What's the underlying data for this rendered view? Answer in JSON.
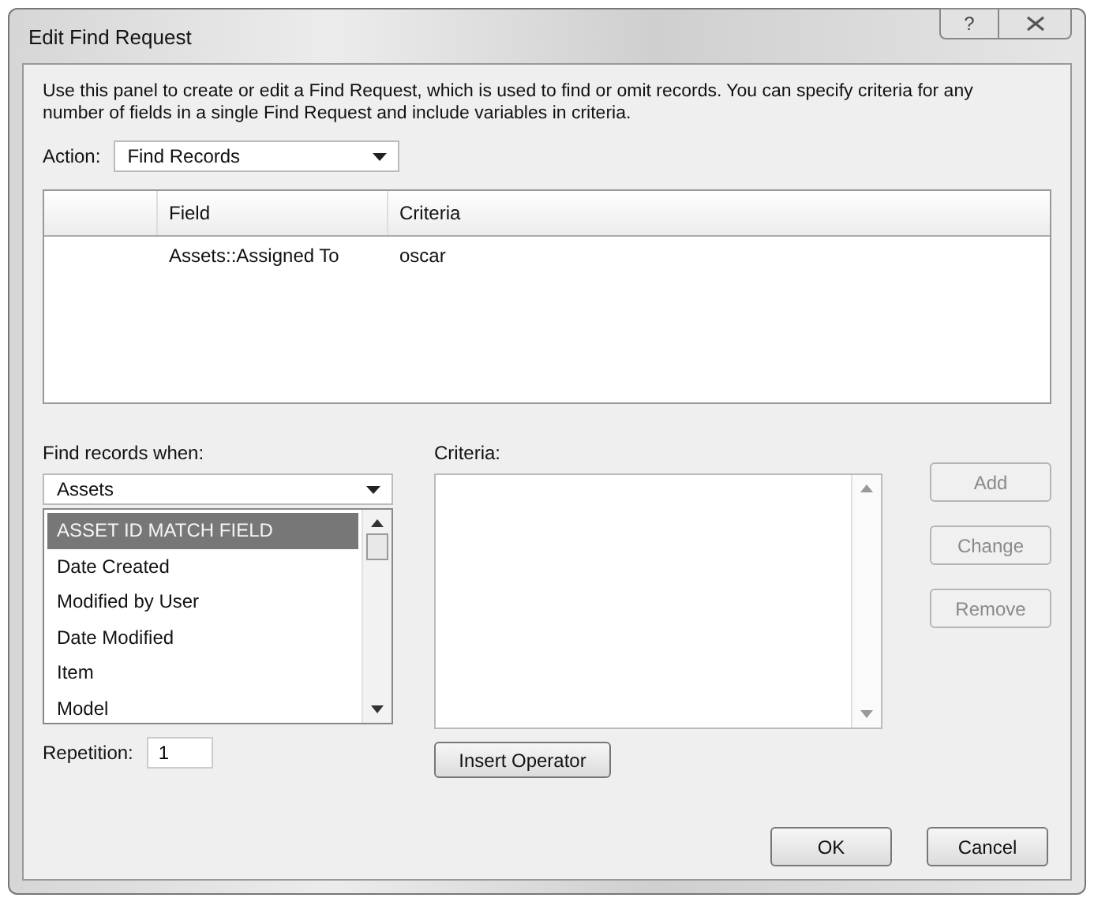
{
  "window": {
    "title": "Edit Find Request",
    "help": "?"
  },
  "description": "Use this panel to create or edit a Find Request, which is used to find or omit records. You can specify criteria for any number of fields in a single Find Request and include variables in criteria.",
  "action": {
    "label": "Action:",
    "value": "Find Records"
  },
  "table": {
    "columns": [
      "Field",
      "Criteria"
    ],
    "rows": [
      {
        "field": "Assets::Assigned To",
        "criteria": "oscar"
      }
    ]
  },
  "find_when": {
    "label": "Find records when:",
    "table_value": "Assets",
    "fields": [
      {
        "label": "ASSET ID MATCH FIELD",
        "selected": true
      },
      {
        "label": "Date Created",
        "selected": false
      },
      {
        "label": "Modified by User",
        "selected": false
      },
      {
        "label": "Date Modified",
        "selected": false
      },
      {
        "label": "Item",
        "selected": false
      },
      {
        "label": "Model",
        "selected": false
      }
    ]
  },
  "criteria": {
    "label": "Criteria:"
  },
  "side_buttons": [
    {
      "label": "Add",
      "disabled": true
    },
    {
      "label": "Change",
      "disabled": true
    },
    {
      "label": "Remove",
      "disabled": true
    }
  ],
  "repetition": {
    "label": "Repetition:",
    "value": "1"
  },
  "insert_operator": "Insert Operator",
  "footer_buttons": [
    "OK",
    "Cancel"
  ]
}
